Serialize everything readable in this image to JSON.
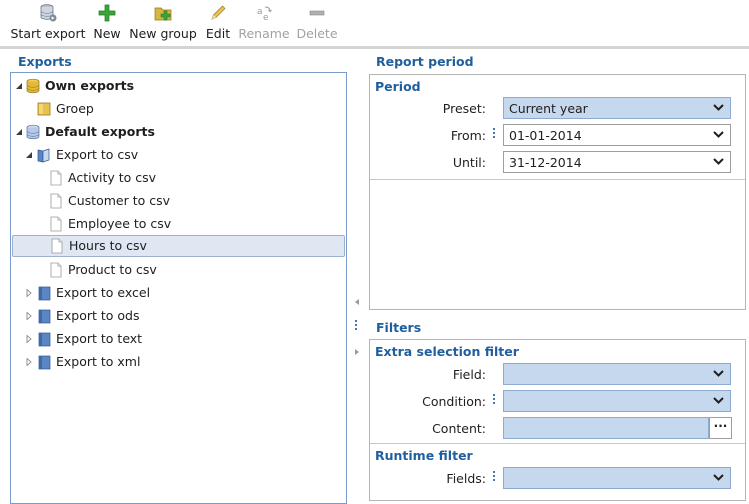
{
  "toolbar": {
    "start_export": "Start export",
    "new": "New",
    "new_group": "New group",
    "edit": "Edit",
    "rename": "Rename",
    "delete": "Delete"
  },
  "exports_pane": {
    "title": "Exports",
    "tree": [
      {
        "label": "Own exports",
        "level": 0,
        "expanded": true,
        "bold": true,
        "icon": "database-gold-icon"
      },
      {
        "label": "Groep",
        "level": 1,
        "icon": "folder-group-icon"
      },
      {
        "label": "Default exports",
        "level": 0,
        "expanded": true,
        "bold": true,
        "icon": "database-blue-icon"
      },
      {
        "label": "Export to csv",
        "level": 1,
        "expanded": true,
        "icon": "book-open-icon"
      },
      {
        "label": "Activity to csv",
        "level": 2,
        "icon": "document-icon"
      },
      {
        "label": "Customer to csv",
        "level": 2,
        "icon": "document-icon"
      },
      {
        "label": "Employee to csv",
        "level": 2,
        "icon": "document-icon"
      },
      {
        "label": "Hours to csv",
        "level": 2,
        "icon": "document-icon",
        "selected": true
      },
      {
        "label": "Product to csv",
        "level": 2,
        "icon": "document-icon"
      },
      {
        "label": "Export to excel",
        "level": 1,
        "expanded": false,
        "icon": "book-closed-icon"
      },
      {
        "label": "Export to ods",
        "level": 1,
        "expanded": false,
        "icon": "book-closed-icon"
      },
      {
        "label": "Export to text",
        "level": 1,
        "expanded": false,
        "icon": "book-closed-icon"
      },
      {
        "label": "Export to xml",
        "level": 1,
        "expanded": false,
        "icon": "book-closed-icon"
      }
    ]
  },
  "report_period": {
    "title": "Report period",
    "period": {
      "title": "Period",
      "preset_label": "Preset:",
      "preset_value": "Current year",
      "from_label": "From:",
      "from_value": "01-01-2014",
      "until_label": "Until:",
      "until_value": "31-12-2014"
    }
  },
  "filters": {
    "title": "Filters",
    "extra_selection": {
      "title": "Extra selection filter",
      "field_label": "Field:",
      "condition_label": "Condition:",
      "content_label": "Content:",
      "ellipsis": "···"
    },
    "runtime": {
      "title": "Runtime filter",
      "fields_label": "Fields:"
    }
  },
  "colors": {
    "accent": "#1f5f9f",
    "combo_fill": "#c6d8ee",
    "selection": "#dfe7f2"
  }
}
